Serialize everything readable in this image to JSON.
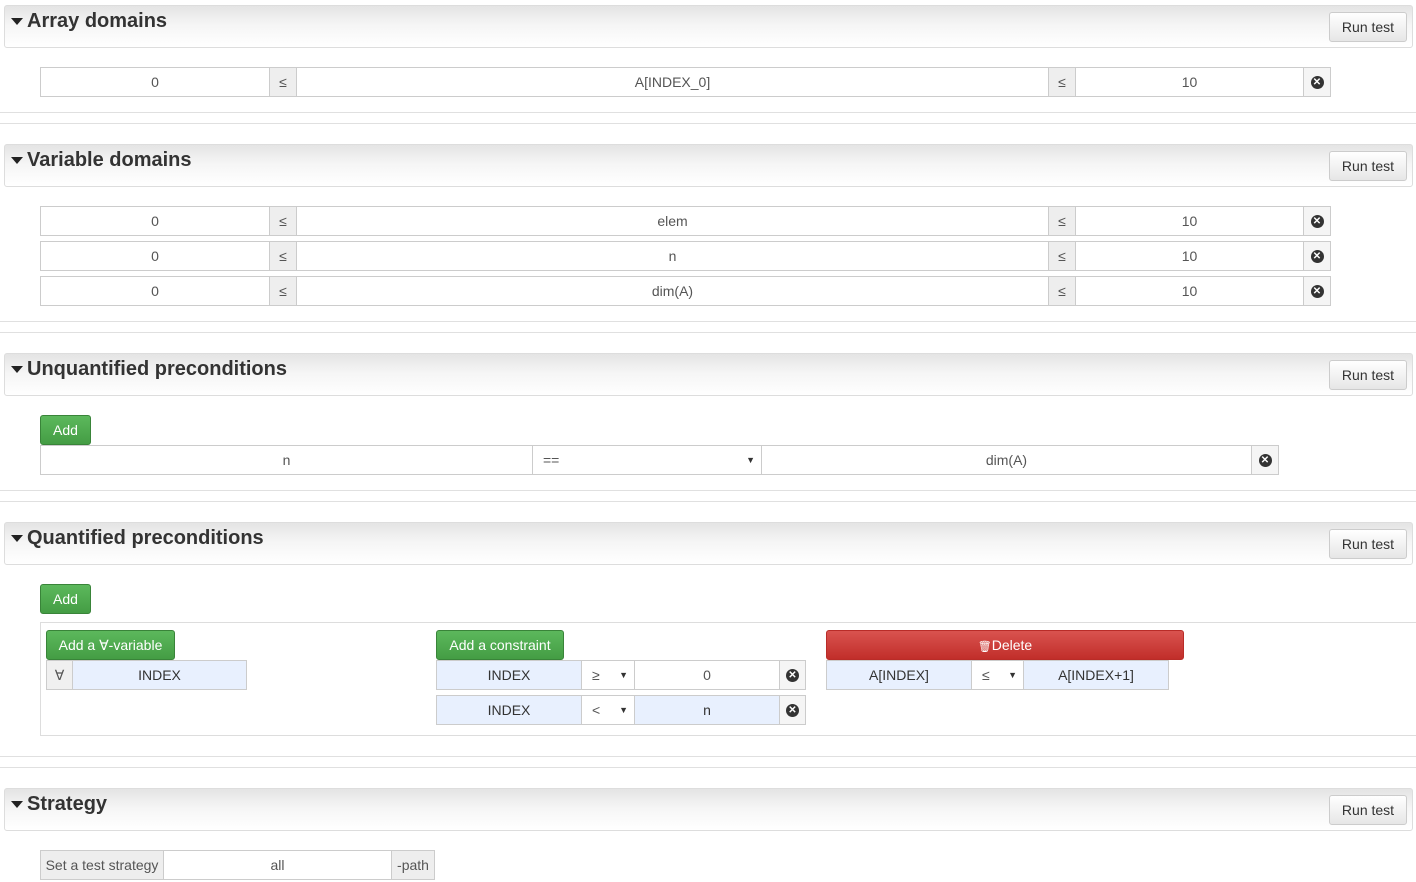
{
  "sections": {
    "array_domains": {
      "title": "Array domains",
      "run_test": "Run test"
    },
    "variable_domains": {
      "title": "Variable domains",
      "run_test": "Run test"
    },
    "unquantified": {
      "title": "Unquantified preconditions",
      "run_test": "Run test",
      "add": "Add"
    },
    "quantified": {
      "title": "Quantified preconditions",
      "run_test": "Run test",
      "add": "Add"
    },
    "strategy": {
      "title": "Strategy",
      "run_test": "Run test"
    }
  },
  "array_domains": [
    {
      "lower": "0",
      "op1": "≤",
      "expr": "A[INDEX_0]",
      "op2": "≤",
      "upper": "10"
    }
  ],
  "variable_domains": [
    {
      "lower": "0",
      "op1": "≤",
      "expr": "elem",
      "op2": "≤",
      "upper": "10"
    },
    {
      "lower": "0",
      "op1": "≤",
      "expr": "n",
      "op2": "≤",
      "upper": "10"
    },
    {
      "lower": "0",
      "op1": "≤",
      "expr": "dim(A)",
      "op2": "≤",
      "upper": "10"
    }
  ],
  "unquantified_row": {
    "left": "n",
    "operator": "==",
    "right": "dim(A)"
  },
  "quantified": {
    "add_variable": "Add a ∀-variable",
    "forall_symbol": "∀",
    "variable": "INDEX",
    "add_constraint": "Add a constraint",
    "constraints": [
      {
        "var": "INDEX",
        "op": "≥",
        "value": "0"
      },
      {
        "var": "INDEX",
        "op": "<",
        "value": "n"
      }
    ],
    "delete": "Delete",
    "body": {
      "left": "A[INDEX]",
      "op": "≤",
      "right": "A[INDEX+1]"
    }
  },
  "strategy": {
    "label": "Set a test strategy",
    "value": "all",
    "suffix": "-path"
  },
  "icons": {
    "caret": "caret-down-icon",
    "remove": "remove-circle-icon",
    "trash": "trash-icon",
    "select": "chevron-down-icon"
  }
}
